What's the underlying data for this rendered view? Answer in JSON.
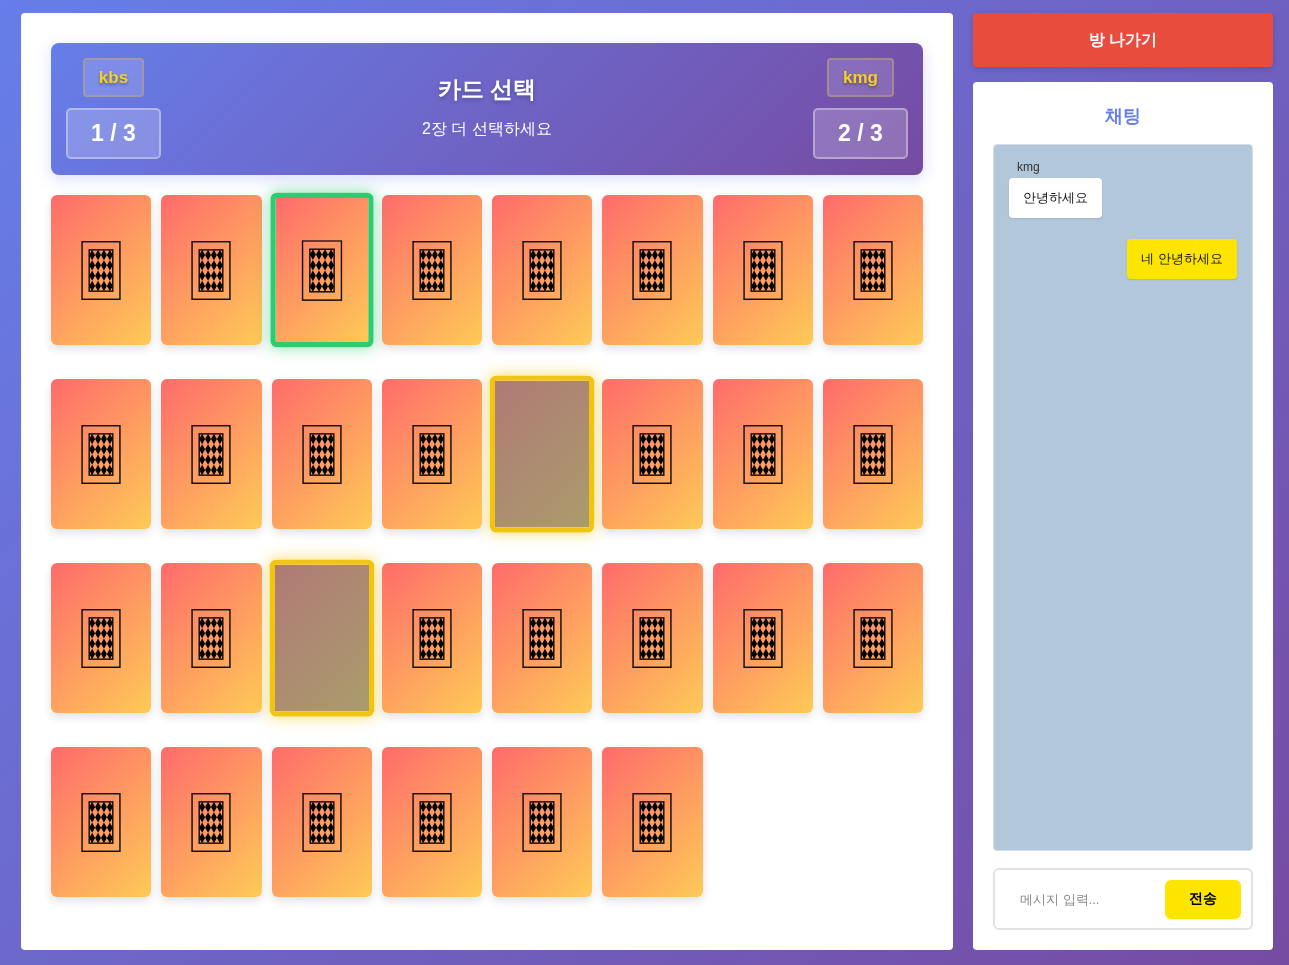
{
  "header": {
    "title": "카드 선택",
    "subtitle": "2장 더 선택하세요",
    "players": [
      {
        "name": "kbs",
        "score": "1 / 3"
      },
      {
        "name": "kmg",
        "score": "2 / 3"
      }
    ]
  },
  "cards": [
    {
      "selected": false,
      "taken": false
    },
    {
      "selected": false,
      "taken": false
    },
    {
      "selected": true,
      "taken": false
    },
    {
      "selected": false,
      "taken": false
    },
    {
      "selected": false,
      "taken": false
    },
    {
      "selected": false,
      "taken": false
    },
    {
      "selected": false,
      "taken": false
    },
    {
      "selected": false,
      "taken": false
    },
    {
      "selected": false,
      "taken": false
    },
    {
      "selected": false,
      "taken": false
    },
    {
      "selected": false,
      "taken": false
    },
    {
      "selected": false,
      "taken": false
    },
    {
      "selected": false,
      "taken": true
    },
    {
      "selected": false,
      "taken": false
    },
    {
      "selected": false,
      "taken": false
    },
    {
      "selected": false,
      "taken": false
    },
    {
      "selected": false,
      "taken": false
    },
    {
      "selected": false,
      "taken": false
    },
    {
      "selected": false,
      "taken": true
    },
    {
      "selected": false,
      "taken": false
    },
    {
      "selected": false,
      "taken": false
    },
    {
      "selected": false,
      "taken": false
    },
    {
      "selected": false,
      "taken": false
    },
    {
      "selected": false,
      "taken": false
    },
    {
      "selected": false,
      "taken": false
    },
    {
      "selected": false,
      "taken": false
    },
    {
      "selected": false,
      "taken": false
    },
    {
      "selected": false,
      "taken": false
    },
    {
      "selected": false,
      "taken": false
    },
    {
      "selected": false,
      "taken": false
    }
  ],
  "leave_button": {
    "label": "방 나가기"
  },
  "chat": {
    "title": "채팅",
    "messages": [
      {
        "sender": "kmg",
        "text": "안녕하세요",
        "mine": false
      },
      {
        "text": "네 안녕하세요",
        "mine": true
      }
    ],
    "input": {
      "placeholder": "메시지 입력..."
    },
    "send_button": {
      "label": "전송"
    }
  }
}
